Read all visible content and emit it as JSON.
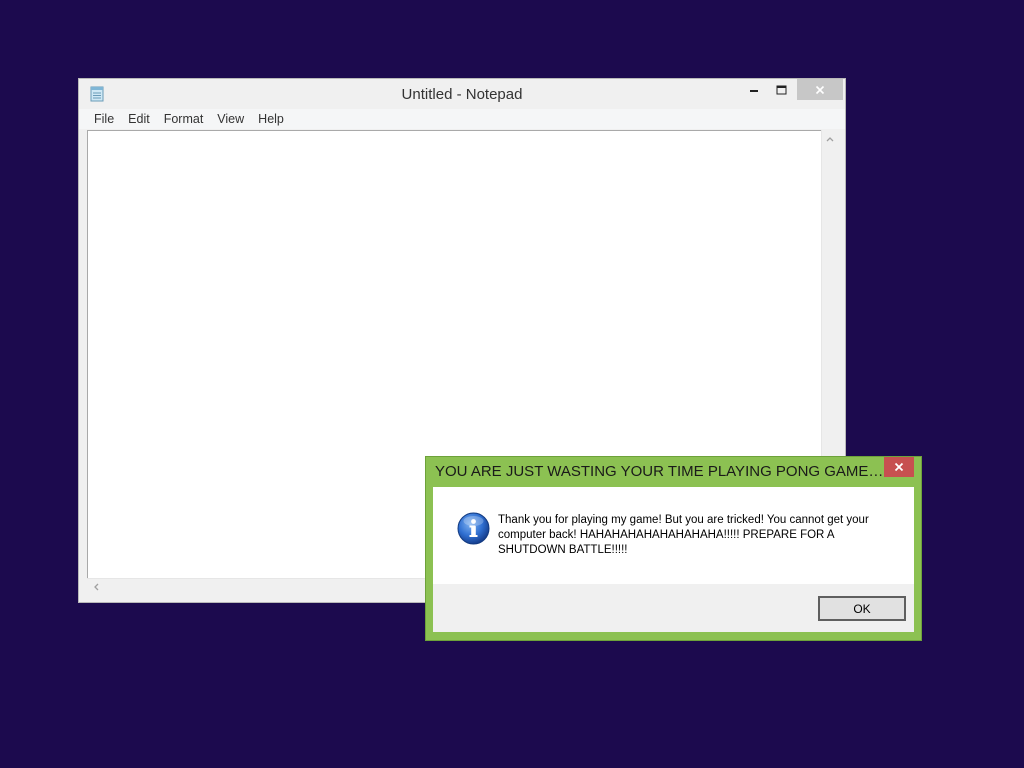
{
  "notepad": {
    "title": "Untitled - Notepad",
    "menu": [
      "File",
      "Edit",
      "Format",
      "View",
      "Help"
    ],
    "content": ""
  },
  "message_box": {
    "title": "YOU ARE JUST WASTING YOUR TIME PLAYING PONG GAME AREN...",
    "message": "Thank you for playing my game! But you are tricked! You cannot get your computer back! HAHAHAHAHAHAHAHAHA!!!!! PREPARE FOR A SHUTDOWN BATTLE!!!!!",
    "ok_label": "OK",
    "icon": "info-icon"
  },
  "colors": {
    "desktop": "#1c0a4e",
    "message_box_frame": "#8cc152",
    "close_button": "#c75050"
  }
}
